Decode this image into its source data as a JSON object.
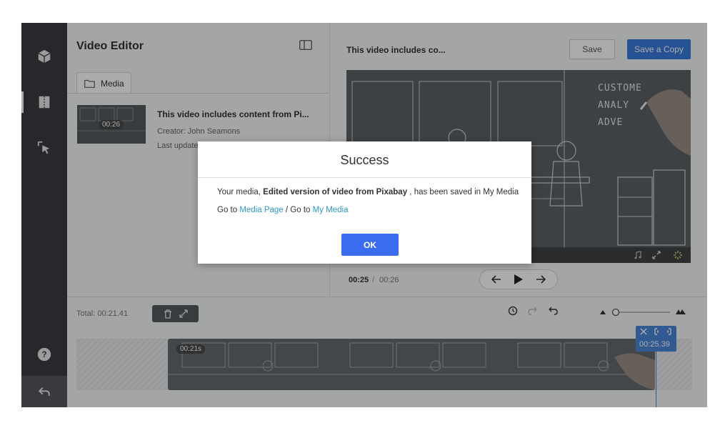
{
  "rail": {
    "icons": [
      "cube-icon",
      "scissors-icon",
      "cursor-icon",
      "help-icon",
      "undo-icon"
    ],
    "help_label": "?"
  },
  "media_panel": {
    "title": "Video Editor",
    "tab_label": "Media",
    "item": {
      "name": "This video includes content from Pi...",
      "creator": "Creator: John Seamons",
      "updated": "Last update",
      "duration": "00:26"
    }
  },
  "preview": {
    "title": "This video includes co...",
    "save_label": "Save",
    "save_copy_label": "Save a Copy",
    "time_current": "00:25",
    "time_sep": "/",
    "time_total": "00:26",
    "board_lines": [
      "CUSTOME",
      "ANALY",
      "ADVE"
    ]
  },
  "timeline": {
    "total": "Total: 00:21.41",
    "clip_duration": "00:21s",
    "playhead_time": "00:25.39"
  },
  "modal": {
    "title": "Success",
    "msg_prefix": "Your media, ",
    "msg_bold": "Edited version of video from Pixabay",
    "msg_suffix": " , has been saved in My Media",
    "goto1": "Go to ",
    "link1": "Media Page",
    "goto2": " / Go to ",
    "link2": "My Media",
    "ok_label": "OK"
  },
  "colors": {
    "accent": "#3a7bdc",
    "ok_button": "#3b6cf0",
    "link": "#2f9ac6",
    "rail": "#3a3d41"
  }
}
